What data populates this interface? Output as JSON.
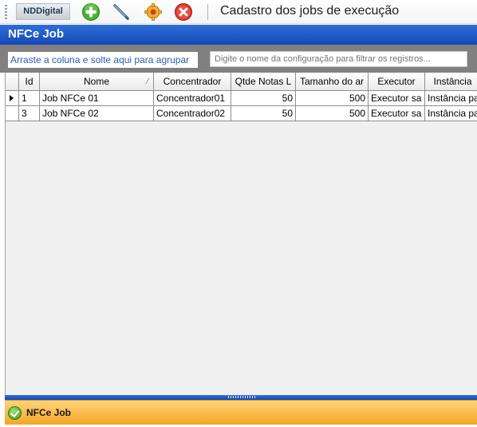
{
  "toolbar": {
    "logo_text": "NDDigital",
    "title": "Cadastro dos jobs de execução",
    "buttons": [
      {
        "name": "add-icon",
        "color": "#3aa02a"
      },
      {
        "name": "edit-pencil-icon",
        "color": "#5a7fb0"
      },
      {
        "name": "settings-gear-icon",
        "color": "#e8a020"
      },
      {
        "name": "delete-icon",
        "color": "#d22a2a"
      }
    ]
  },
  "header": {
    "title": "NFCe Job",
    "color": "#1f5cc8"
  },
  "grouping": {
    "hint": "Arraste a coluna e solte aqui para agrupar",
    "filter_placeholder": "Digite o nome da configuração para filtrar os registros..."
  },
  "grid": {
    "columns": [
      "Id",
      "Nome",
      "Concentrador",
      "Qtde Notas L",
      "Tamanho do ar",
      "Executor",
      "Instância"
    ],
    "rows": [
      {
        "id": "1",
        "nome": "Job NFCe 01",
        "concentrador": "Concentrador01",
        "qtde": "50",
        "tamanho": "500",
        "executor": "Executor sa",
        "instancia": "Instância pa",
        "current": true
      },
      {
        "id": "3",
        "nome": "Job NFCe 02",
        "concentrador": "Concentrador02",
        "qtde": "50",
        "tamanho": "500",
        "executor": "Executor sa",
        "instancia": "Instância pa",
        "current": false
      }
    ]
  },
  "navigation": {
    "item_label": "NFCe Job",
    "accent": "#f5a623"
  }
}
